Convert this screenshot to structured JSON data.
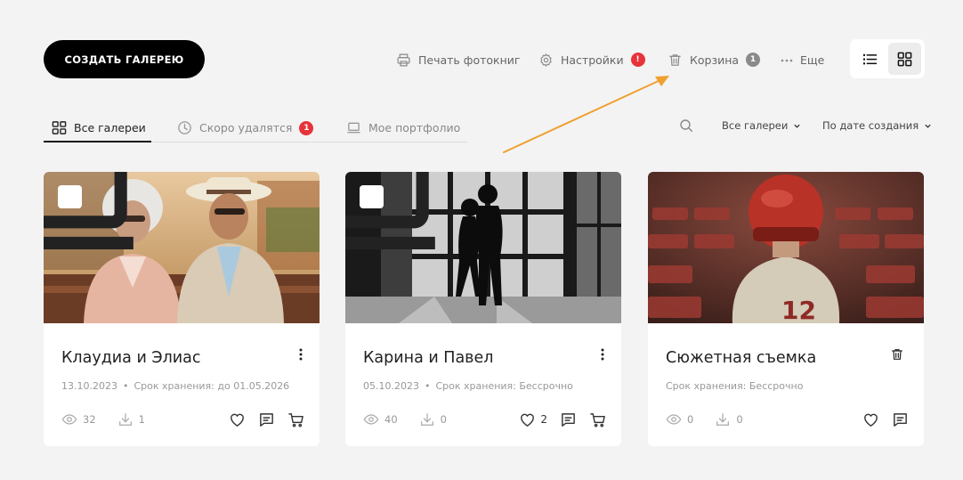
{
  "header": {
    "create_label": "СОЗДАТЬ ГАЛЕРЕЮ",
    "print_label": "Печать фотокниг",
    "settings_label": "Настройки",
    "settings_badge": "!",
    "trash_label": "Корзина",
    "trash_badge": "1",
    "more_label": "Еще"
  },
  "tabs": [
    {
      "label": "Все галереи",
      "active": true
    },
    {
      "label": "Скоро удалятся",
      "badge": "1"
    },
    {
      "label": "Мое портфолио"
    }
  ],
  "filters": {
    "scope": "Все галереи",
    "sort": "По дате создания"
  },
  "colors": {
    "accent_badge": "#e8333b",
    "gray_badge": "#8a8a8a",
    "annotation_arrow": "#f0a030"
  },
  "cards": [
    {
      "title": "Клаудиа и Элиас",
      "date": "13.10.2023",
      "storage": "Срок хранения: до 01.05.2026",
      "views": "32",
      "downloads": "1",
      "portfolio": true
    },
    {
      "title": "Карина и Павел",
      "date": "05.10.2023",
      "storage": "Срок хранения: Бессрочно",
      "views": "40",
      "downloads": "0",
      "likes": "2",
      "portfolio": true
    },
    {
      "title": "Сюжетная съемка",
      "storage": "Срок хранения: Бессрочно",
      "views": "0",
      "downloads": "0",
      "portfolio": false
    }
  ]
}
